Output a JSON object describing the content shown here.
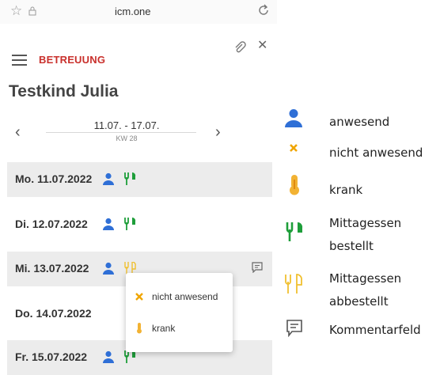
{
  "browser": {
    "domain": "icm.one"
  },
  "header": {
    "section_title": "BETREUUNG",
    "child_name": "Testkind Julia"
  },
  "week": {
    "range": "11.07. - 17.07.",
    "number": "KW 28"
  },
  "days": [
    {
      "label": "Mo. 11.07.2022",
      "status": "anwesend",
      "meal": "bestellt",
      "comment": false
    },
    {
      "label": "Di. 12.07.2022",
      "status": "anwesend",
      "meal": "bestellt",
      "comment": false
    },
    {
      "label": "Mi. 13.07.2022",
      "status": "anwesend",
      "meal": "abbestellt",
      "comment": true
    },
    {
      "label": "Do. 14.07.2022",
      "status": "",
      "meal": "",
      "comment": false
    },
    {
      "label": "Fr. 15.07.2022",
      "status": "anwesend",
      "meal": "bestellt",
      "comment": false
    }
  ],
  "popup": {
    "items": [
      {
        "label": "nicht anwesend",
        "icon": "x-icon"
      },
      {
        "label": "krank",
        "icon": "thermometer-icon"
      }
    ]
  },
  "legend": {
    "items": [
      {
        "label": "anwesend",
        "icon": "person-icon"
      },
      {
        "label": "nicht anwesend",
        "icon": "x-icon"
      },
      {
        "label": "krank",
        "icon": "thermometer-icon"
      },
      {
        "label_line1": "Mittagessen",
        "label_line2": "bestellt",
        "icon": "fork-knife-icon"
      },
      {
        "label_line1": "Mittagessen",
        "label_line2": "abbestellt",
        "icon": "fork-knife-outline-icon"
      },
      {
        "label": "Kommentarfeld",
        "icon": "comment-icon"
      }
    ]
  },
  "colors": {
    "person": "#2f6fd6",
    "meal_ordered": "#1e9e3a",
    "meal_cancelled": "#f0c030",
    "accent": "#c9302c",
    "x": "#f0a500",
    "thermo": "#f2b233"
  }
}
